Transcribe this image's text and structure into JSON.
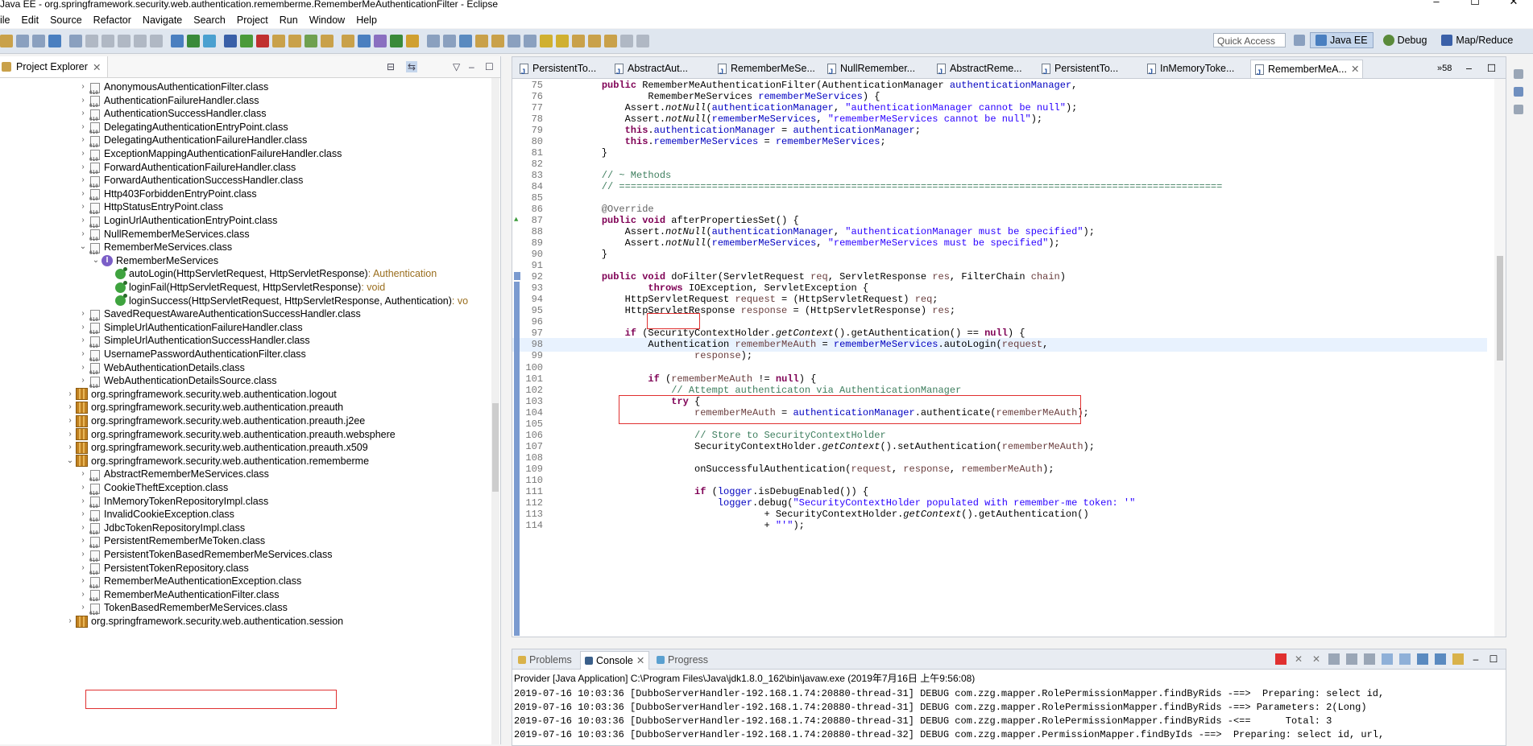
{
  "window": {
    "title": "Java EE - org.springframework.security.web.authentication.rememberme.RememberMeAuthenticationFilter - Eclipse",
    "controls": [
      "–",
      "☐",
      "✕"
    ]
  },
  "menu": [
    "ile",
    "Edit",
    "Source",
    "Refactor",
    "Navigate",
    "Search",
    "Project",
    "Run",
    "Window",
    "Help"
  ],
  "toolbar": {
    "quick_access": "Quick Access",
    "perspectives": [
      "Java EE",
      "Debug",
      "Map/Reduce"
    ]
  },
  "explorer": {
    "title": "Project Explorer",
    "rows": [
      {
        "indent": 1,
        "arrow": "›",
        "icon": "class",
        "label": "AnonymousAuthenticationFilter.class"
      },
      {
        "indent": 1,
        "arrow": "›",
        "icon": "class",
        "label": "AuthenticationFailureHandler.class"
      },
      {
        "indent": 1,
        "arrow": "›",
        "icon": "class",
        "label": "AuthenticationSuccessHandler.class"
      },
      {
        "indent": 1,
        "arrow": "›",
        "icon": "class",
        "label": "DelegatingAuthenticationEntryPoint.class"
      },
      {
        "indent": 1,
        "arrow": "›",
        "icon": "class",
        "label": "DelegatingAuthenticationFailureHandler.class"
      },
      {
        "indent": 1,
        "arrow": "›",
        "icon": "class",
        "label": "ExceptionMappingAuthenticationFailureHandler.class"
      },
      {
        "indent": 1,
        "arrow": "›",
        "icon": "class",
        "label": "ForwardAuthenticationFailureHandler.class"
      },
      {
        "indent": 1,
        "arrow": "›",
        "icon": "class",
        "label": "ForwardAuthenticationSuccessHandler.class"
      },
      {
        "indent": 1,
        "arrow": "›",
        "icon": "class",
        "label": "Http403ForbiddenEntryPoint.class"
      },
      {
        "indent": 1,
        "arrow": "›",
        "icon": "class",
        "label": "HttpStatusEntryPoint.class"
      },
      {
        "indent": 1,
        "arrow": "›",
        "icon": "class",
        "label": "LoginUrlAuthenticationEntryPoint.class"
      },
      {
        "indent": 1,
        "arrow": "›",
        "icon": "class",
        "label": "NullRememberMeServices.class"
      },
      {
        "indent": 1,
        "arrow": "⌄",
        "icon": "class",
        "label": "RememberMeServices.class"
      },
      {
        "indent": 2,
        "arrow": "⌄",
        "icon": "interface",
        "label": "RememberMeServices"
      },
      {
        "indent": 3,
        "arrow": "",
        "icon": "method",
        "label": "autoLogin(HttpServletRequest, HttpServletResponse)",
        "ret": " : Authentication"
      },
      {
        "indent": 3,
        "arrow": "",
        "icon": "method",
        "label": "loginFail(HttpServletRequest, HttpServletResponse)",
        "ret": " : void"
      },
      {
        "indent": 3,
        "arrow": "",
        "icon": "method",
        "label": "loginSuccess(HttpServletRequest, HttpServletResponse, Authentication)",
        "ret": " : vo"
      },
      {
        "indent": 1,
        "arrow": "›",
        "icon": "class",
        "label": "SavedRequestAwareAuthenticationSuccessHandler.class"
      },
      {
        "indent": 1,
        "arrow": "›",
        "icon": "class",
        "label": "SimpleUrlAuthenticationFailureHandler.class"
      },
      {
        "indent": 1,
        "arrow": "›",
        "icon": "class",
        "label": "SimpleUrlAuthenticationSuccessHandler.class"
      },
      {
        "indent": 1,
        "arrow": "›",
        "icon": "class",
        "label": "UsernamePasswordAuthenticationFilter.class"
      },
      {
        "indent": 1,
        "arrow": "›",
        "icon": "class",
        "label": "WebAuthenticationDetails.class"
      },
      {
        "indent": 1,
        "arrow": "›",
        "icon": "class",
        "label": "WebAuthenticationDetailsSource.class"
      },
      {
        "indent": 0,
        "arrow": "›",
        "icon": "package",
        "label": "org.springframework.security.web.authentication.logout"
      },
      {
        "indent": 0,
        "arrow": "›",
        "icon": "package",
        "label": "org.springframework.security.web.authentication.preauth"
      },
      {
        "indent": 0,
        "arrow": "›",
        "icon": "package",
        "label": "org.springframework.security.web.authentication.preauth.j2ee"
      },
      {
        "indent": 0,
        "arrow": "›",
        "icon": "package",
        "label": "org.springframework.security.web.authentication.preauth.websphere"
      },
      {
        "indent": 0,
        "arrow": "›",
        "icon": "package",
        "label": "org.springframework.security.web.authentication.preauth.x509"
      },
      {
        "indent": 0,
        "arrow": "⌄",
        "icon": "package",
        "label": "org.springframework.security.web.authentication.rememberme"
      },
      {
        "indent": 1,
        "arrow": "›",
        "icon": "class",
        "label": "AbstractRememberMeServices.class"
      },
      {
        "indent": 1,
        "arrow": "›",
        "icon": "class",
        "label": "CookieTheftException.class"
      },
      {
        "indent": 1,
        "arrow": "›",
        "icon": "class",
        "label": "InMemoryTokenRepositoryImpl.class"
      },
      {
        "indent": 1,
        "arrow": "›",
        "icon": "class",
        "label": "InvalidCookieException.class"
      },
      {
        "indent": 1,
        "arrow": "›",
        "icon": "class",
        "label": "JdbcTokenRepositoryImpl.class"
      },
      {
        "indent": 1,
        "arrow": "›",
        "icon": "class",
        "label": "PersistentRememberMeToken.class"
      },
      {
        "indent": 1,
        "arrow": "›",
        "icon": "class",
        "label": "PersistentTokenBasedRememberMeServices.class"
      },
      {
        "indent": 1,
        "arrow": "›",
        "icon": "class",
        "label": "PersistentTokenRepository.class"
      },
      {
        "indent": 1,
        "arrow": "›",
        "icon": "class",
        "label": "RememberMeAuthenticationException.class"
      },
      {
        "indent": 1,
        "arrow": "›",
        "icon": "class",
        "label": "RememberMeAuthenticationFilter.class"
      },
      {
        "indent": 1,
        "arrow": "›",
        "icon": "class",
        "label": "TokenBasedRememberMeServices.class"
      },
      {
        "indent": 0,
        "arrow": "›",
        "icon": "package",
        "label": "org.springframework.security.web.authentication.session"
      }
    ]
  },
  "editor": {
    "tabs": [
      "PersistentTo...",
      "AbstractAut...",
      "RememberMeSe...",
      "NullRemember...",
      "AbstractReme...",
      "PersistentTo...",
      "InMemoryToke...",
      "RememberMeA..."
    ],
    "overflow": "»58",
    "lines": [
      {
        "n": "75",
        "t": "    public RememberMeAuthenticationFilter(AuthenticationManager authenticationManager,"
      },
      {
        "n": "76",
        "t": "            RememberMeServices rememberMeServices) {"
      },
      {
        "n": "77",
        "t": "        Assert.notNull(authenticationManager, \"authenticationManager cannot be null\");"
      },
      {
        "n": "78",
        "t": "        Assert.notNull(rememberMeServices, \"rememberMeServices cannot be null\");"
      },
      {
        "n": "79",
        "t": "        this.authenticationManager = authenticationManager;"
      },
      {
        "n": "80",
        "t": "        this.rememberMeServices = rememberMeServices;"
      },
      {
        "n": "81",
        "t": "    }"
      },
      {
        "n": "82",
        "t": ""
      },
      {
        "n": "83",
        "t": "    // ~ Methods"
      },
      {
        "n": "84",
        "t": "    // ========================================================================================================"
      },
      {
        "n": "85",
        "t": ""
      },
      {
        "n": "86",
        "t": "    @Override"
      },
      {
        "n": "87",
        "t": "    public void afterPropertiesSet() {"
      },
      {
        "n": "88",
        "t": "        Assert.notNull(authenticationManager, \"authenticationManager must be specified\");"
      },
      {
        "n": "89",
        "t": "        Assert.notNull(rememberMeServices, \"rememberMeServices must be specified\");"
      },
      {
        "n": "90",
        "t": "    }"
      },
      {
        "n": "91",
        "t": ""
      },
      {
        "n": "92",
        "t": "    public void doFilter(ServletRequest req, ServletResponse res, FilterChain chain)"
      },
      {
        "n": "93",
        "t": "            throws IOException, ServletException {"
      },
      {
        "n": "94",
        "t": "        HttpServletRequest request = (HttpServletRequest) req;"
      },
      {
        "n": "95",
        "t": "        HttpServletResponse response = (HttpServletResponse) res;"
      },
      {
        "n": "96",
        "t": ""
      },
      {
        "n": "97",
        "t": "        if (SecurityContextHolder.getContext().getAuthentication() == null) {"
      },
      {
        "n": "98",
        "t": "            Authentication rememberMeAuth = rememberMeServices.autoLogin(request,"
      },
      {
        "n": "99",
        "t": "                    response);"
      },
      {
        "n": "100",
        "t": ""
      },
      {
        "n": "101",
        "t": "            if (rememberMeAuth != null) {"
      },
      {
        "n": "102",
        "t": "                // Attempt authenticaton via AuthenticationManager"
      },
      {
        "n": "103",
        "t": "                try {"
      },
      {
        "n": "104",
        "t": "                    rememberMeAuth = authenticationManager.authenticate(rememberMeAuth);"
      },
      {
        "n": "105",
        "t": ""
      },
      {
        "n": "106",
        "t": "                    // Store to SecurityContextHolder"
      },
      {
        "n": "107",
        "t": "                    SecurityContextHolder.getContext().setAuthentication(rememberMeAuth);"
      },
      {
        "n": "108",
        "t": ""
      },
      {
        "n": "109",
        "t": "                    onSuccessfulAuthentication(request, response, rememberMeAuth);"
      },
      {
        "n": "110",
        "t": ""
      },
      {
        "n": "111",
        "t": "                    if (logger.isDebugEnabled()) {"
      },
      {
        "n": "112",
        "t": "                        logger.debug(\"SecurityContextHolder populated with remember-me token: '\""
      },
      {
        "n": "113",
        "t": "                                + SecurityContextHolder.getContext().getAuthentication()"
      },
      {
        "n": "114",
        "t": "                                + \"'\");"
      }
    ]
  },
  "console": {
    "tabs": [
      "Problems",
      "Console",
      "Progress"
    ],
    "description": "Provider [Java Application] C:\\Program Files\\Java\\jdk1.8.0_162\\bin\\javaw.exe (2019年7月16日 上午9:56:08)",
    "log": [
      "2019-07-16 10:03:36 [DubboServerHandler-192.168.1.74:20880-thread-31] DEBUG com.zzg.mapper.RolePermissionMapper.findByRids -==>  Preparing: select id,",
      "2019-07-16 10:03:36 [DubboServerHandler-192.168.1.74:20880-thread-31] DEBUG com.zzg.mapper.RolePermissionMapper.findByRids -==> Parameters: 2(Long)",
      "2019-07-16 10:03:36 [DubboServerHandler-192.168.1.74:20880-thread-31] DEBUG com.zzg.mapper.RolePermissionMapper.findByRids -<==      Total: 3",
      "2019-07-16 10:03:36 [DubboServerHandler-192.168.1.74:20880-thread-32] DEBUG com.zzg.mapper.PermissionMapper.findByIds -==>  Preparing: select id, url,"
    ]
  },
  "colors": {
    "highlight_box": "#e03030",
    "keyword": "#7f0055",
    "field": "#0000c0",
    "string": "#2a00ff",
    "comment": "#3f7f5f"
  }
}
